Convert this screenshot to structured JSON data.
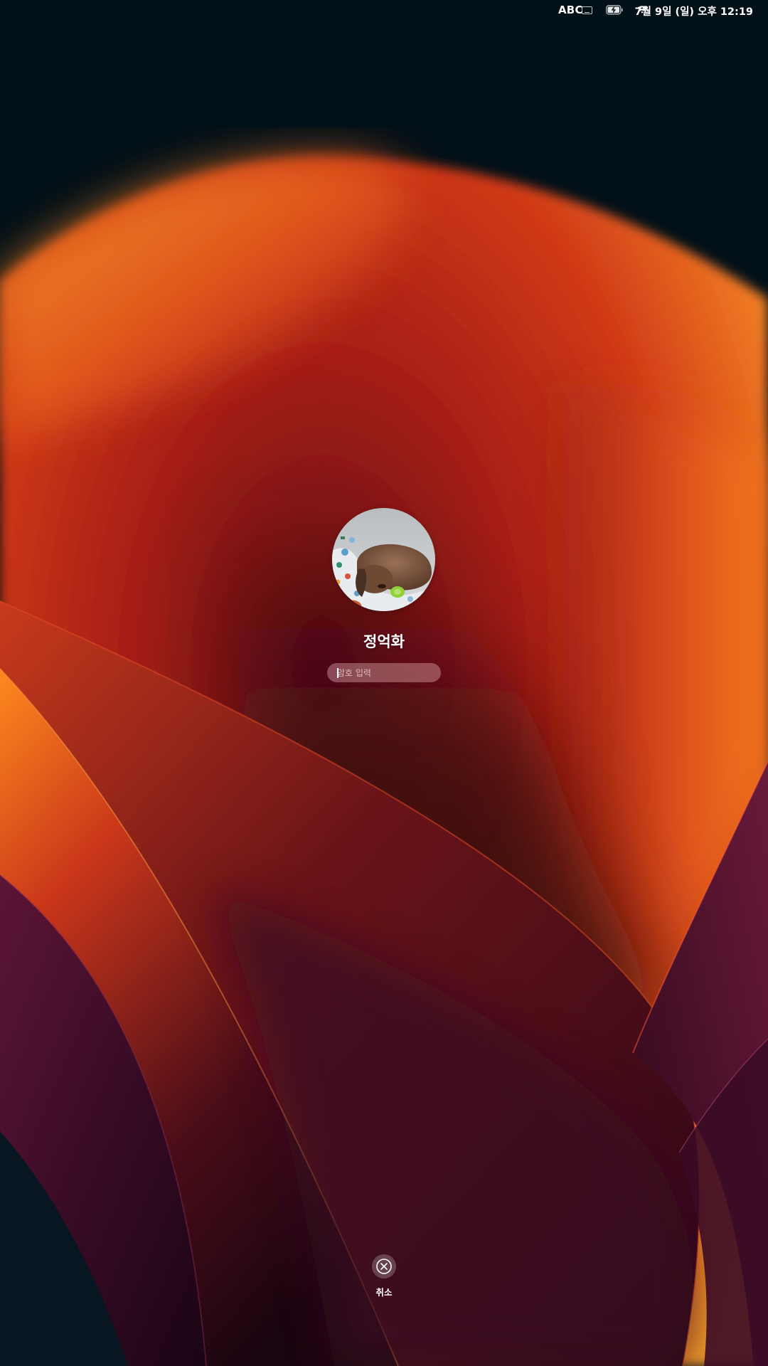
{
  "menubar": {
    "input_source": "ABC",
    "keyboard_icon": "keyboard-icon",
    "battery_icon": "battery-charging-icon",
    "wifi_icon": "wifi-icon",
    "clock": "7월 9일 (일) 오후 12:19"
  },
  "login": {
    "avatar_icon": "user-avatar-photo",
    "username": "정억화",
    "password_placeholder": "암호 입력",
    "password_value": ""
  },
  "cancel": {
    "icon": "close-circle-icon",
    "label": "취소"
  },
  "colors": {
    "background": "#021018",
    "accent_orange": "#f26a1b",
    "accent_red": "#b7241a",
    "accent_purple": "#4a1030"
  }
}
